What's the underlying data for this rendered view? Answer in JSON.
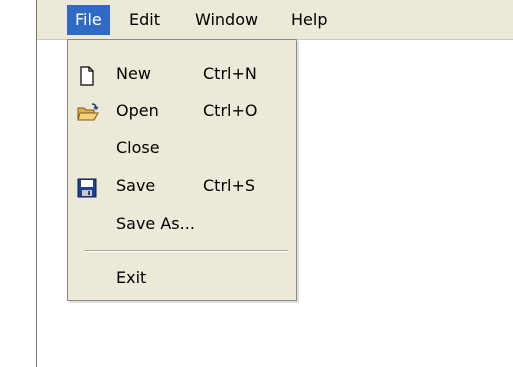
{
  "menubar": {
    "items": [
      {
        "label": "File",
        "active": true
      },
      {
        "label": "Edit"
      },
      {
        "label": "Window"
      },
      {
        "label": "Help"
      }
    ]
  },
  "file_menu": {
    "items": [
      {
        "label": "New",
        "shortcut": "Ctrl+N",
        "icon": "new-document-icon"
      },
      {
        "label": "Open",
        "shortcut": "Ctrl+O",
        "icon": "open-folder-icon"
      },
      {
        "label": "Close",
        "shortcut": "",
        "icon": ""
      },
      {
        "label": "Save",
        "shortcut": "Ctrl+S",
        "icon": "save-disk-icon"
      },
      {
        "label": "Save As...",
        "shortcut": "",
        "icon": ""
      },
      {
        "label": "Exit",
        "shortcut": "",
        "icon": ""
      }
    ]
  },
  "colors": {
    "menubar_bg": "#ece9d8",
    "highlight": "#316ac5",
    "highlight_text": "#ffffff"
  }
}
